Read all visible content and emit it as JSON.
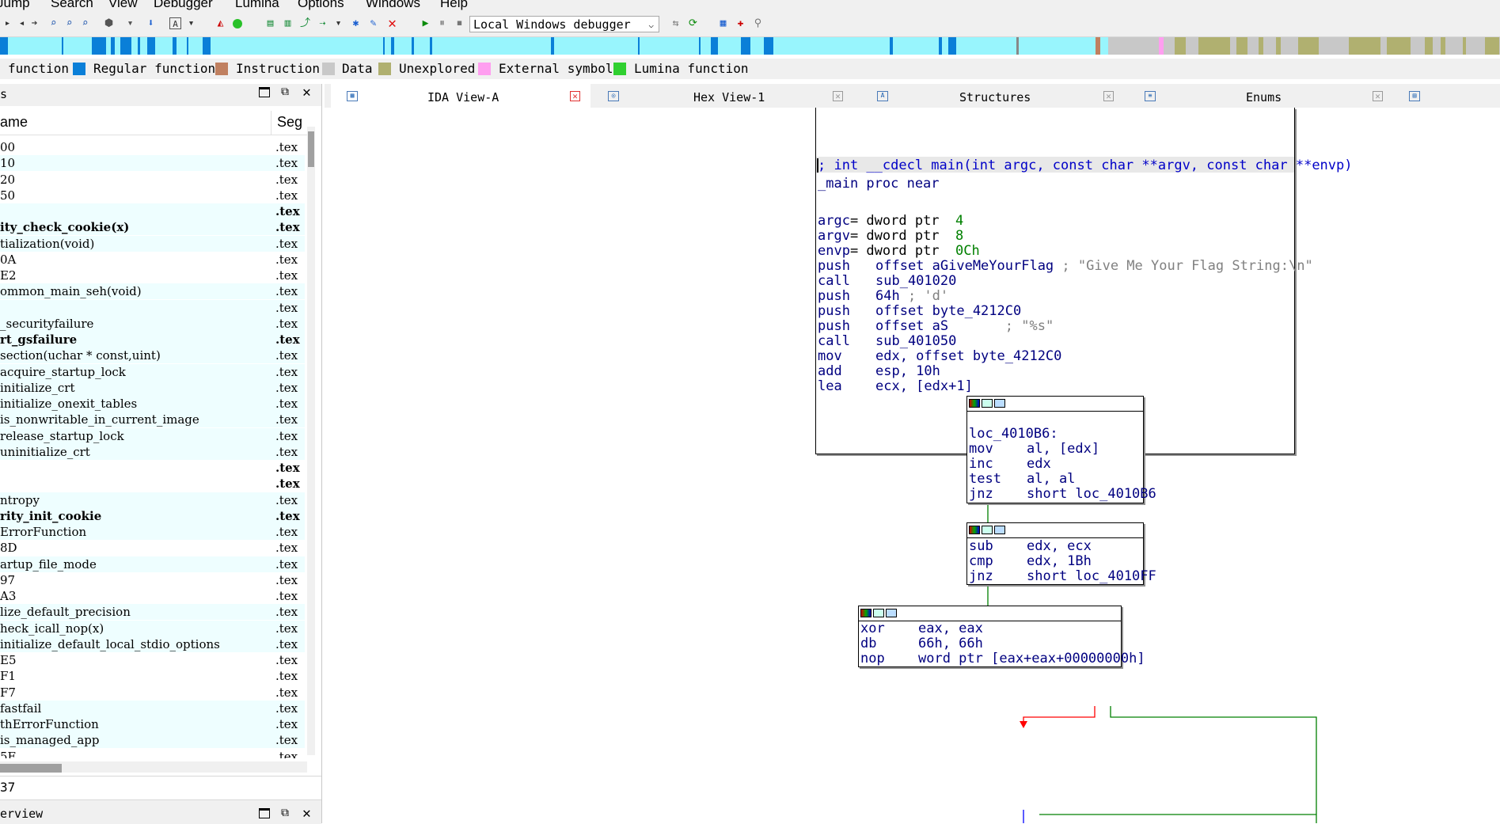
{
  "menubar": [
    "Jump",
    "Search",
    "View",
    "Debugger",
    "Lumina",
    "Options",
    "Windows",
    "Help"
  ],
  "toolbar": {
    "debugger": "Local Windows debugger"
  },
  "legend": [
    {
      "label": "function",
      "color": "#e8f0ff"
    },
    {
      "label": "Regular function",
      "color": "#0a7fd8"
    },
    {
      "label": "Instruction",
      "color": "#c08060"
    },
    {
      "label": "Data",
      "color": "#c8c8c8"
    },
    {
      "label": "Unexplored",
      "color": "#b0b070"
    },
    {
      "label": "External symbol",
      "color": "#ff9ef0"
    },
    {
      "label": "Lumina function",
      "color": "#30d030"
    }
  ],
  "functions_panel": {
    "title": "s",
    "col_name": "ame",
    "col_seg": "Seg",
    "rows": [
      {
        "name": "00",
        "seg": ".tex",
        "bold": false,
        "hl": false
      },
      {
        "name": "10",
        "seg": ".tex",
        "bold": false,
        "hl": true
      },
      {
        "name": "20",
        "seg": ".tex",
        "bold": false,
        "hl": false
      },
      {
        "name": "50",
        "seg": ".tex",
        "bold": false,
        "hl": false
      },
      {
        "name": "",
        "seg": ".tex",
        "bold": true,
        "hl": true
      },
      {
        "name": "ity_check_cookie(x)",
        "seg": ".tex",
        "bold": true,
        "hl": true
      },
      {
        "name": "tialization(void)",
        "seg": ".tex",
        "bold": false,
        "hl": true
      },
      {
        "name": "0A",
        "seg": ".tex",
        "bold": false,
        "hl": false
      },
      {
        "name": "E2",
        "seg": ".tex",
        "bold": false,
        "hl": false
      },
      {
        "name": "ommon_main_seh(void)",
        "seg": ".tex",
        "bold": false,
        "hl": true
      },
      {
        "name": "",
        "seg": ".tex",
        "bold": false,
        "hl": true
      },
      {
        "name": "_securityfailure",
        "seg": ".tex",
        "bold": false,
        "hl": true
      },
      {
        "name": "rt_gsfailure",
        "seg": ".tex",
        "bold": true,
        "hl": true
      },
      {
        "name": "section(uchar * const,uint)",
        "seg": ".tex",
        "bold": false,
        "hl": true
      },
      {
        "name": "acquire_startup_lock",
        "seg": ".tex",
        "bold": false,
        "hl": true
      },
      {
        "name": "initialize_crt",
        "seg": ".tex",
        "bold": false,
        "hl": true
      },
      {
        "name": "initialize_onexit_tables",
        "seg": ".tex",
        "bold": false,
        "hl": true
      },
      {
        "name": "is_nonwritable_in_current_image",
        "seg": ".tex",
        "bold": false,
        "hl": true
      },
      {
        "name": "release_startup_lock",
        "seg": ".tex",
        "bold": false,
        "hl": true
      },
      {
        "name": "uninitialize_crt",
        "seg": ".tex",
        "bold": false,
        "hl": true
      },
      {
        "name": "",
        "seg": ".tex",
        "bold": true,
        "hl": false
      },
      {
        "name": "",
        "seg": ".tex",
        "bold": true,
        "hl": false
      },
      {
        "name": "ntropy",
        "seg": ".tex",
        "bold": false,
        "hl": true
      },
      {
        "name": "rity_init_cookie",
        "seg": ".tex",
        "bold": true,
        "hl": true
      },
      {
        "name": "ErrorFunction",
        "seg": ".tex",
        "bold": false,
        "hl": true
      },
      {
        "name": "8D",
        "seg": ".tex",
        "bold": false,
        "hl": false
      },
      {
        "name": "artup_file_mode",
        "seg": ".tex",
        "bold": false,
        "hl": true
      },
      {
        "name": "97",
        "seg": ".tex",
        "bold": false,
        "hl": false
      },
      {
        "name": "A3",
        "seg": ".tex",
        "bold": false,
        "hl": false
      },
      {
        "name": "lize_default_precision",
        "seg": ".tex",
        "bold": false,
        "hl": true
      },
      {
        "name": "heck_icall_nop(x)",
        "seg": ".tex",
        "bold": false,
        "hl": true
      },
      {
        "name": "initialize_default_local_stdio_options",
        "seg": ".tex",
        "bold": false,
        "hl": true
      },
      {
        "name": "E5",
        "seg": ".tex",
        "bold": false,
        "hl": false
      },
      {
        "name": "F1",
        "seg": ".tex",
        "bold": false,
        "hl": false
      },
      {
        "name": "F7",
        "seg": ".tex",
        "bold": false,
        "hl": false
      },
      {
        "name": "fastfail",
        "seg": ".tex",
        "bold": false,
        "hl": true
      },
      {
        "name": "thErrorFunction",
        "seg": ".tex",
        "bold": false,
        "hl": true
      },
      {
        "name": "is_managed_app",
        "seg": ".tex",
        "bold": false,
        "hl": true
      },
      {
        "name": "5F",
        "seg": ".tex",
        "bold": false,
        "hl": false
      }
    ],
    "line_info": "37"
  },
  "overview_panel": {
    "title": "erview"
  },
  "tabs": [
    {
      "label": "IDA View-A",
      "active": true
    },
    {
      "label": "Hex View-1",
      "active": false
    },
    {
      "label": "Structures",
      "active": false
    },
    {
      "label": "Enums",
      "active": false
    }
  ],
  "graph": {
    "block1": {
      "proto": "; int __cdecl main(int argc, const char **argv, const char **envp)",
      "proc": "_main proc near",
      "vars": [
        {
          "name": "argc",
          "def": "= dword ptr  ",
          "val": "4"
        },
        {
          "name": "argv",
          "def": "= dword ptr  ",
          "val": "8"
        },
        {
          "name": "envp",
          "def": "= dword ptr  ",
          "val": "0Ch"
        }
      ],
      "instr": [
        {
          "op": "push",
          "arg": "offset aGiveMeYourFlag",
          "cmt": " ; \"Give Me Your Flag String:\\n\""
        },
        {
          "op": "call",
          "arg": "sub_401020",
          "cmt": ""
        },
        {
          "op": "push",
          "arg": "64h",
          "cmt": " ; 'd'"
        },
        {
          "op": "push",
          "arg": "offset byte_4212C0",
          "cmt": ""
        },
        {
          "op": "push",
          "arg": "offset aS",
          "cmt": "       ; \"%s\""
        },
        {
          "op": "call",
          "arg": "sub_401050",
          "cmt": ""
        },
        {
          "op": "mov",
          "arg": "edx, offset byte_4212C0",
          "cmt": ""
        },
        {
          "op": "add",
          "arg": "esp, 10h",
          "cmt": ""
        },
        {
          "op": "lea",
          "arg": "ecx, [edx+1]",
          "cmt": ""
        }
      ]
    },
    "block2": {
      "label": "loc_4010B6:",
      "instr": [
        {
          "op": "mov",
          "arg": "al, [edx]"
        },
        {
          "op": "inc",
          "arg": "edx"
        },
        {
          "op": "test",
          "arg": "al, al"
        },
        {
          "op": "jnz",
          "arg": "short loc_4010B6"
        }
      ]
    },
    "block3": {
      "instr": [
        {
          "op": "sub",
          "arg": "edx, ecx"
        },
        {
          "op": "cmp",
          "arg": "edx, 1Bh"
        },
        {
          "op": "jnz",
          "arg": "short loc_4010FF"
        }
      ]
    },
    "block4": {
      "instr": [
        {
          "op": "xor",
          "arg": "eax, eax"
        },
        {
          "op": "db",
          "arg": "66h, 66h"
        },
        {
          "op": "nop",
          "arg": "word ptr [eax+eax+00000000h]"
        }
      ]
    }
  }
}
